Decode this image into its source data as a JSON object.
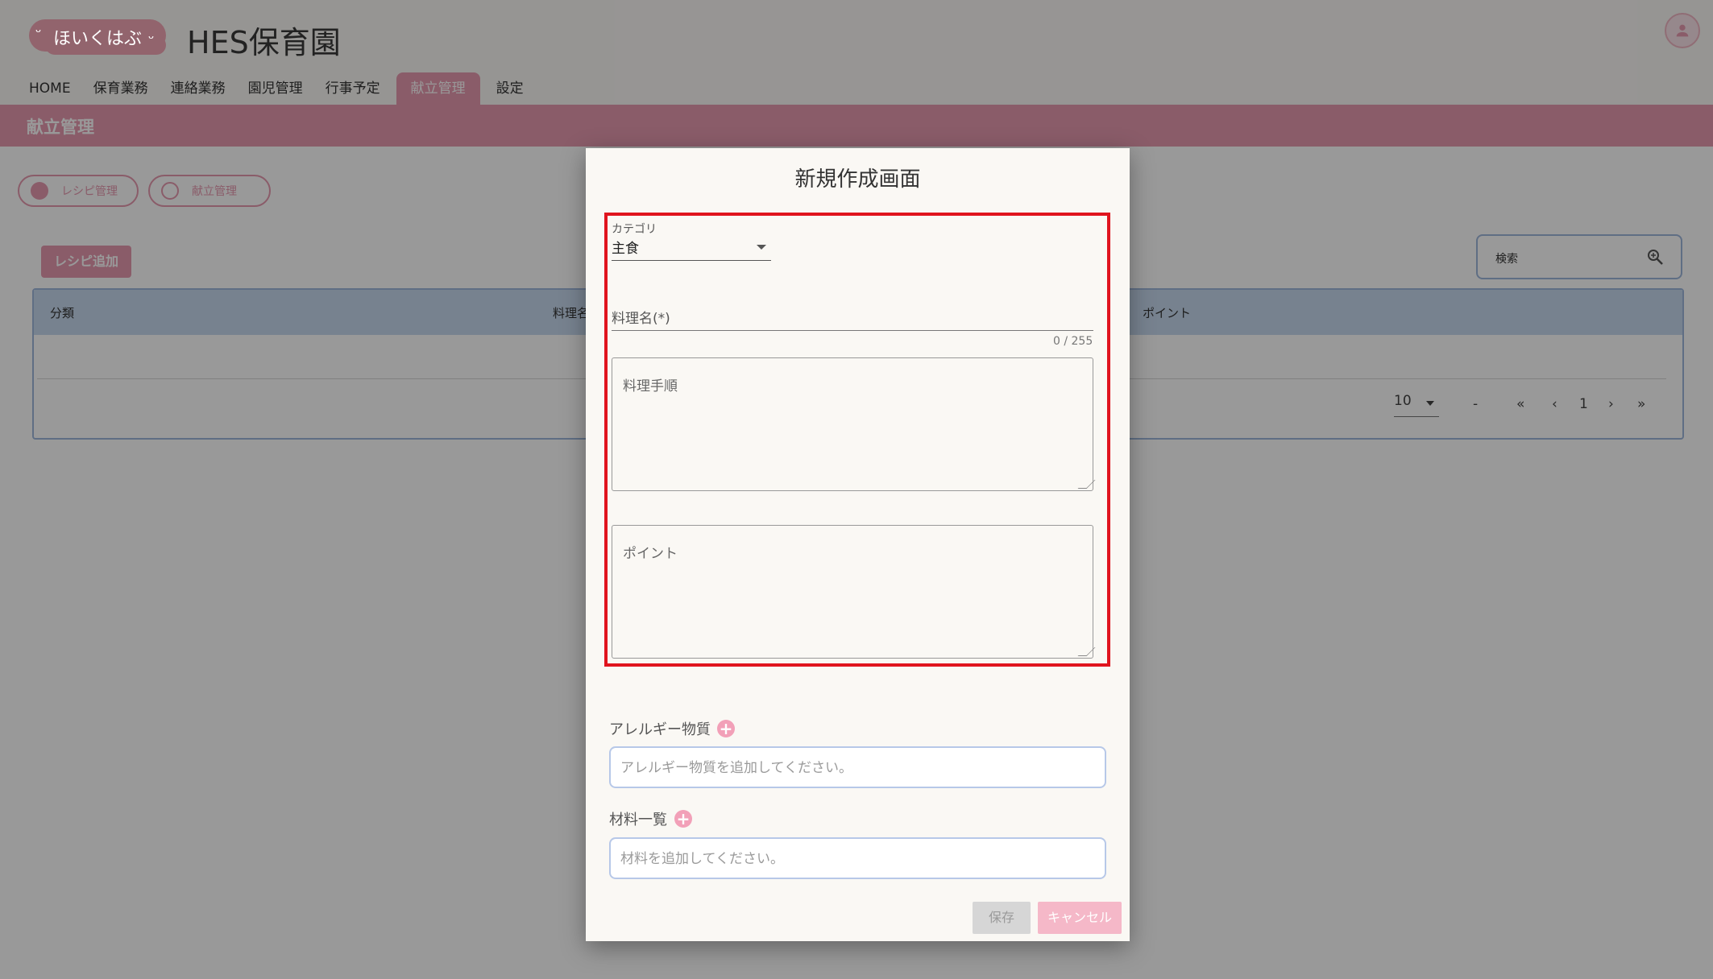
{
  "app": {
    "logo_text": "ほいくはぶ",
    "title": "HES保育園"
  },
  "nav": {
    "items": [
      "HOME",
      "保育業務",
      "連絡業務",
      "園児管理",
      "行事予定",
      "献立管理",
      "設定"
    ],
    "active_index": 5
  },
  "page": {
    "header": "献立管理",
    "tab_pills": [
      "レシピ管理",
      "献立管理"
    ],
    "add_button": "レシピ追加",
    "search_label": "検索",
    "table": {
      "columns": [
        "分類",
        "料理名",
        "ポイント"
      ]
    },
    "pager": {
      "page_size": "10",
      "range": "-",
      "current_page": "1"
    }
  },
  "modal": {
    "title": "新規作成画面",
    "category": {
      "label": "カテゴリ",
      "value": "主食"
    },
    "dish_name": {
      "label": "料理名(*)",
      "counter": "0 / 255"
    },
    "steps_placeholder": "料理手順",
    "point_placeholder": "ポイント",
    "allergens": {
      "label": "アレルギー物質",
      "placeholder": "アレルギー物質を追加してください。"
    },
    "ingredients": {
      "label": "材料一覧",
      "placeholder": "材料を追加してください。"
    },
    "save_label": "保存",
    "cancel_label": "キャンセル"
  },
  "colors": {
    "accent_pink": "#e79ab0",
    "table_header_blue": "#c7d9ee",
    "highlight_red": "#e0141e"
  }
}
